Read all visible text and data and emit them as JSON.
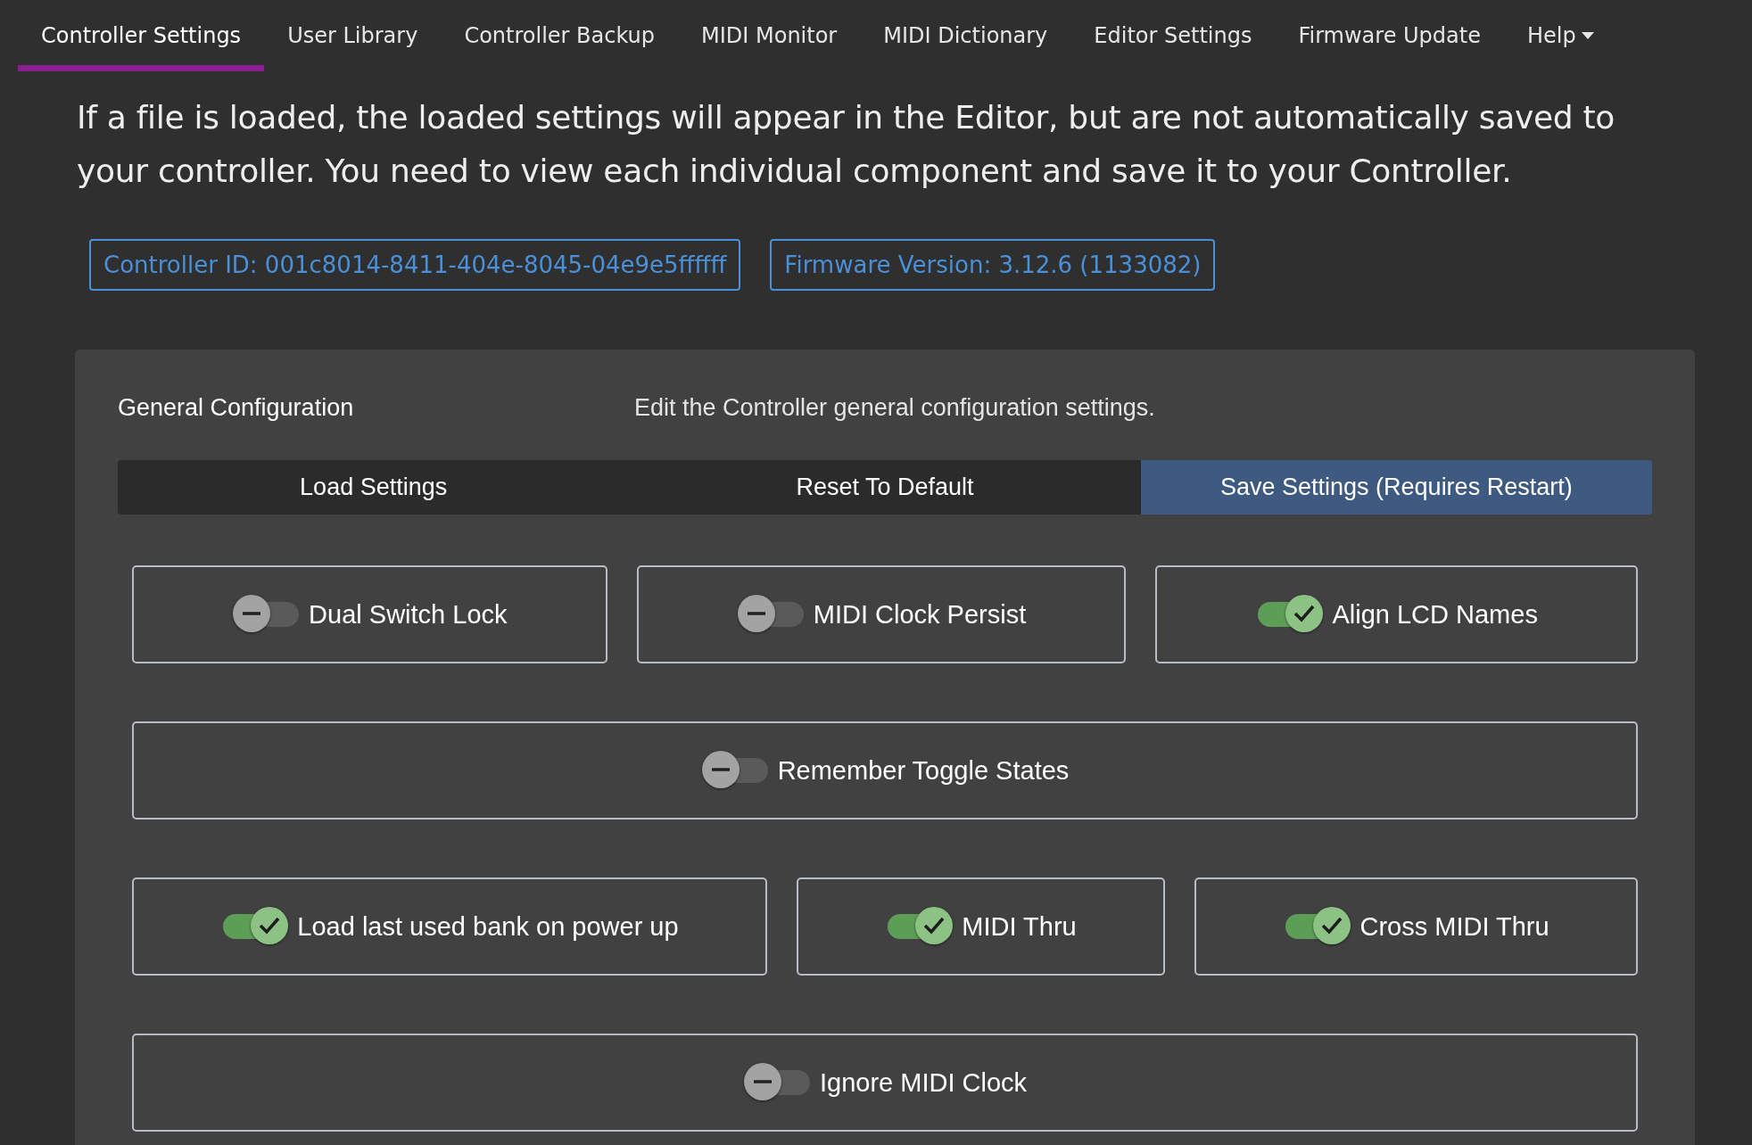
{
  "nav": {
    "items": [
      {
        "label": "Controller Settings",
        "selected": true
      },
      {
        "label": "User Library",
        "selected": false
      },
      {
        "label": "Controller Backup",
        "selected": false
      },
      {
        "label": "MIDI Monitor",
        "selected": false
      },
      {
        "label": "MIDI Dictionary",
        "selected": false
      },
      {
        "label": "Editor Settings",
        "selected": false
      },
      {
        "label": "Firmware Update",
        "selected": false
      },
      {
        "label": "Help",
        "selected": false,
        "kind": "dropdown"
      }
    ]
  },
  "intro": "If a file is loaded, the loaded settings will appear in the Editor, but are not automatically saved to your controller. You need to view each individual component and save it to your Controller.",
  "badges": [
    "Controller ID: 001c8014-8411-404e-8045-04e9e5ffffff",
    "Firmware Version: 3.12.6 (1133082)"
  ],
  "panel": {
    "title": "General Configuration",
    "description": "Edit the Controller general configuration settings.",
    "actions": [
      {
        "label": "Load Settings",
        "kind": "dark"
      },
      {
        "label": "Reset To Default",
        "kind": "dark"
      },
      {
        "label": "Save Settings (Requires Restart)",
        "kind": "primary"
      }
    ],
    "rows": [
      [
        {
          "label": "Dual Switch Lock",
          "on": false
        },
        {
          "label": "MIDI Clock Persist",
          "on": false
        },
        {
          "label": "Align LCD Names",
          "on": true
        }
      ],
      [
        {
          "label": "Remember Toggle States",
          "on": false
        }
      ],
      [
        {
          "label": "Load last used bank on power up",
          "on": true
        },
        {
          "label": "MIDI Thru",
          "on": true
        },
        {
          "label": "Cross MIDI Thru",
          "on": true
        }
      ],
      [
        {
          "label": "Ignore MIDI Clock",
          "on": false
        }
      ]
    ]
  }
}
